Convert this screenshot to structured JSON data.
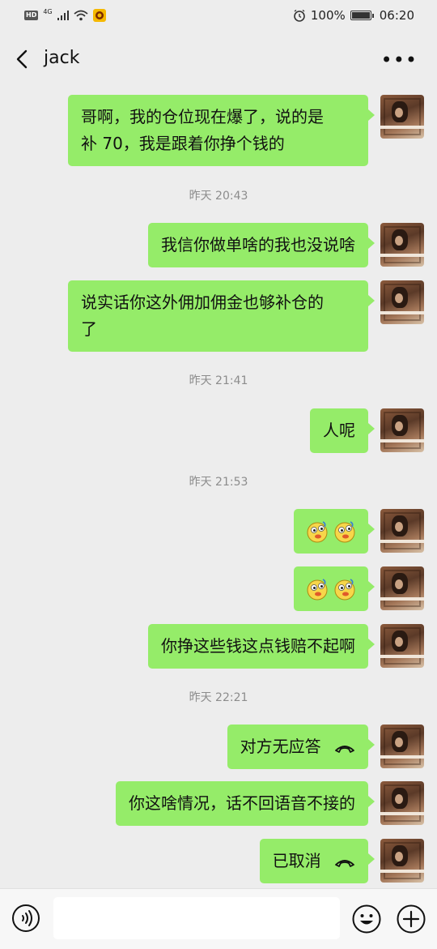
{
  "status_bar": {
    "network": "4G",
    "battery": "100%",
    "battery_level": 1.0,
    "time": "06:20",
    "icons": [
      "hd-icon",
      "signal-icon",
      "wifi-icon",
      "app-notification-icon",
      "alarm-icon",
      "battery-icon"
    ]
  },
  "header": {
    "title": "jack",
    "back_icon": "chevron-left-icon",
    "more_label": "•••"
  },
  "messages": [
    {
      "type": "text",
      "lines": [
        "哥啊，我的仓位现在爆了，说的是",
        "补 70，我是跟着你挣个钱的"
      ]
    },
    {
      "type": "time",
      "text": "昨天 20:43"
    },
    {
      "type": "text",
      "lines": [
        "我信你做单啥的我也没说啥"
      ]
    },
    {
      "type": "text",
      "lines": [
        "说实话你这外佣加佣金也够补仓的",
        "了"
      ]
    },
    {
      "type": "time",
      "text": "昨天 21:41"
    },
    {
      "type": "text",
      "lines": [
        "人呢"
      ]
    },
    {
      "type": "time",
      "text": "昨天 21:53"
    },
    {
      "type": "emoji",
      "emoji_name": "doge-face-emoji",
      "count": 2
    },
    {
      "type": "emoji",
      "emoji_name": "doge-face-emoji",
      "count": 2
    },
    {
      "type": "text",
      "lines": [
        "你挣这些钱这点钱赔不起啊"
      ]
    },
    {
      "type": "time",
      "text": "昨天 22:21"
    },
    {
      "type": "call",
      "text": "对方无应答",
      "icon": "phone-hangup-icon"
    },
    {
      "type": "text",
      "lines": [
        "你这啥情况，话不回语音不接的"
      ]
    },
    {
      "type": "call",
      "text": "已取消",
      "icon": "phone-hangup-icon"
    }
  ],
  "bottom_bar": {
    "input_value": "",
    "icons": [
      "voice-icon",
      "emoji-icon",
      "plus-icon"
    ]
  },
  "colors": {
    "background": "#ededed",
    "bubble_green": "#95ec69",
    "time_gray": "#8c8c8c"
  }
}
